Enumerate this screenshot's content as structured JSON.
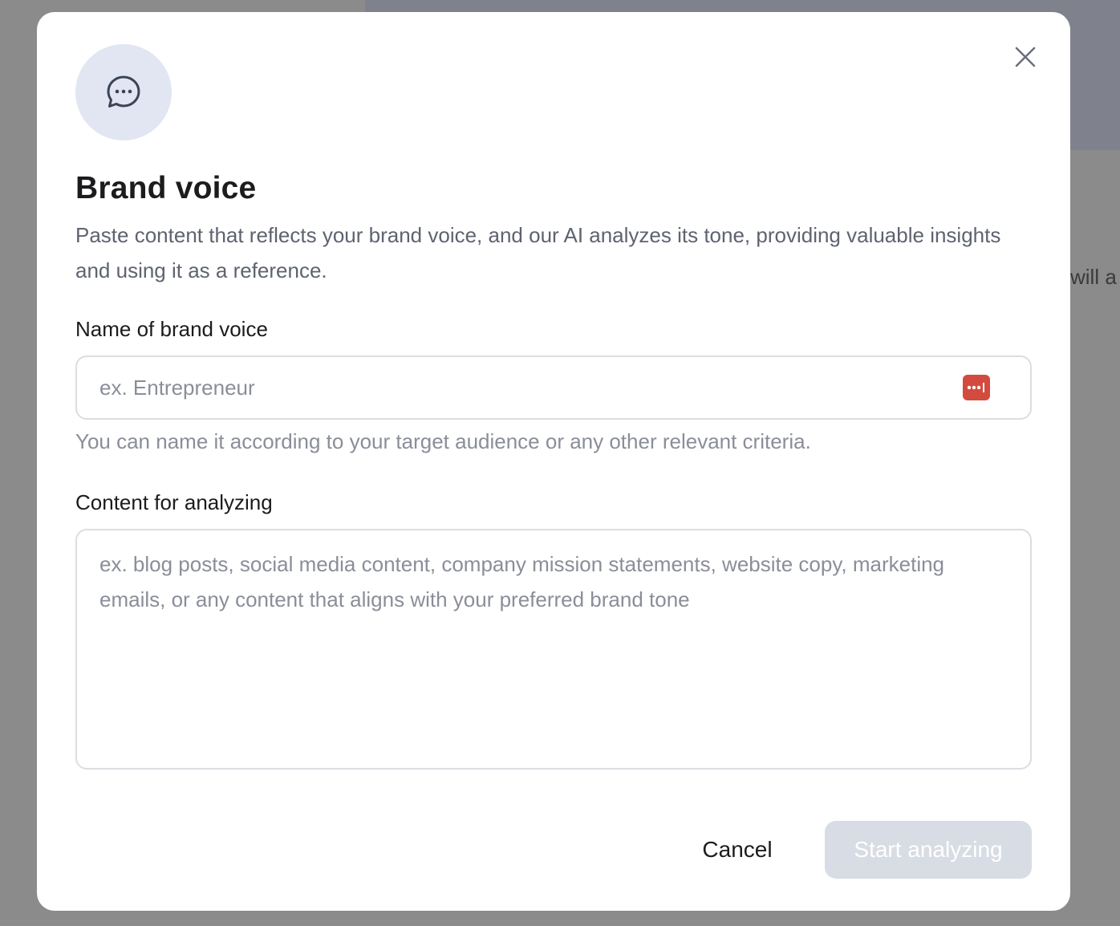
{
  "background": {
    "partial_text": "will a"
  },
  "modal": {
    "icon_name": "chat-bubble-icon",
    "close_icon": "close-icon",
    "title": "Brand voice",
    "description": "Paste content that reflects your brand voice, and our AI analyzes its tone, providing valuable insights and using it as a reference.",
    "name_field": {
      "label": "Name of brand voice",
      "placeholder": "ex. Entrepreneur",
      "value": "",
      "hint": "You can name it according to your target audience or any other relevant criteria.",
      "extension_icon": "password-manager-icon"
    },
    "content_field": {
      "label": "Content for analyzing",
      "placeholder": "ex. blog posts, social media content, company mission statements, website copy, marketing emails, or any content that aligns with your preferred brand tone",
      "value": ""
    },
    "buttons": {
      "cancel": "Cancel",
      "start": "Start analyzing"
    }
  },
  "colors": {
    "overlay": "#8b8b8b",
    "icon_circle_bg": "#e1e6f2",
    "primary_disabled": "#d8dce4",
    "password_icon": "#d24b3e"
  }
}
